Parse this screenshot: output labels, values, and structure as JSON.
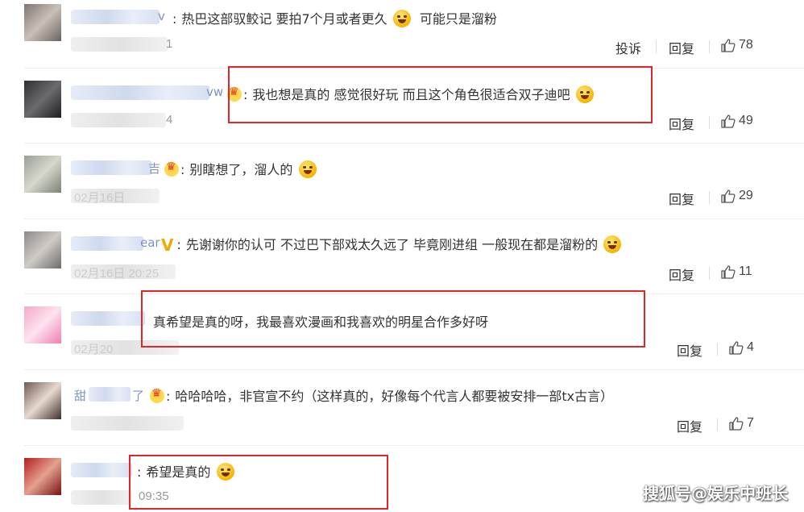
{
  "comments": [
    {
      "name_tail": "v",
      "text": "热巴这部驭鲛记 要拍7个月或者更久",
      "text_after": "可能只是溜粉",
      "time": "1",
      "report_label": "投诉",
      "reply_label": "回复",
      "likes": "78"
    },
    {
      "name_tail": "vw",
      "text": "我也想是真的 感觉很好玩 而且这个角色很适合双子迪吧",
      "time": "4",
      "reply_label": "回复",
      "likes": "49"
    },
    {
      "name_tail": "吉",
      "text": "别瞎想了，溜人的",
      "time": "02月16日",
      "reply_label": "回复",
      "likes": "29"
    },
    {
      "name_tail": "ear",
      "text": "先谢谢你的认可 不过巴下部戏太久远了 毕竟刚进组 一般现在都是溜粉的",
      "time": "02月16日 20:25",
      "reply_label": "回复",
      "likes": "11"
    },
    {
      "name_tail": "",
      "text": "真希望是真的呀，我最喜欢漫画和我喜欢的明星合作多好呀",
      "time": "02月20",
      "reply_label": "回复",
      "likes": "4"
    },
    {
      "name_tail": "了",
      "name_head": "甜",
      "text": "哈哈哈哈，非官宣不约（这样真的，好像每个代言人都要被安排一部tx古言）",
      "time": "",
      "reply_label": "回复",
      "likes": "7"
    },
    {
      "name_tail": "",
      "text": "希望是真的",
      "time": "09:35",
      "likes": ""
    }
  ],
  "watermark": "搜狐号@娱乐中班长",
  "colors": {
    "highlight": "#e0262b",
    "name_link": "#7b95c9",
    "meta": "#999999"
  },
  "icons": {
    "like": "thumbs-up-icon",
    "vip": "crown-badge-icon",
    "verified": "v-badge-icon",
    "emoji": "laughing-emoji-icon"
  }
}
